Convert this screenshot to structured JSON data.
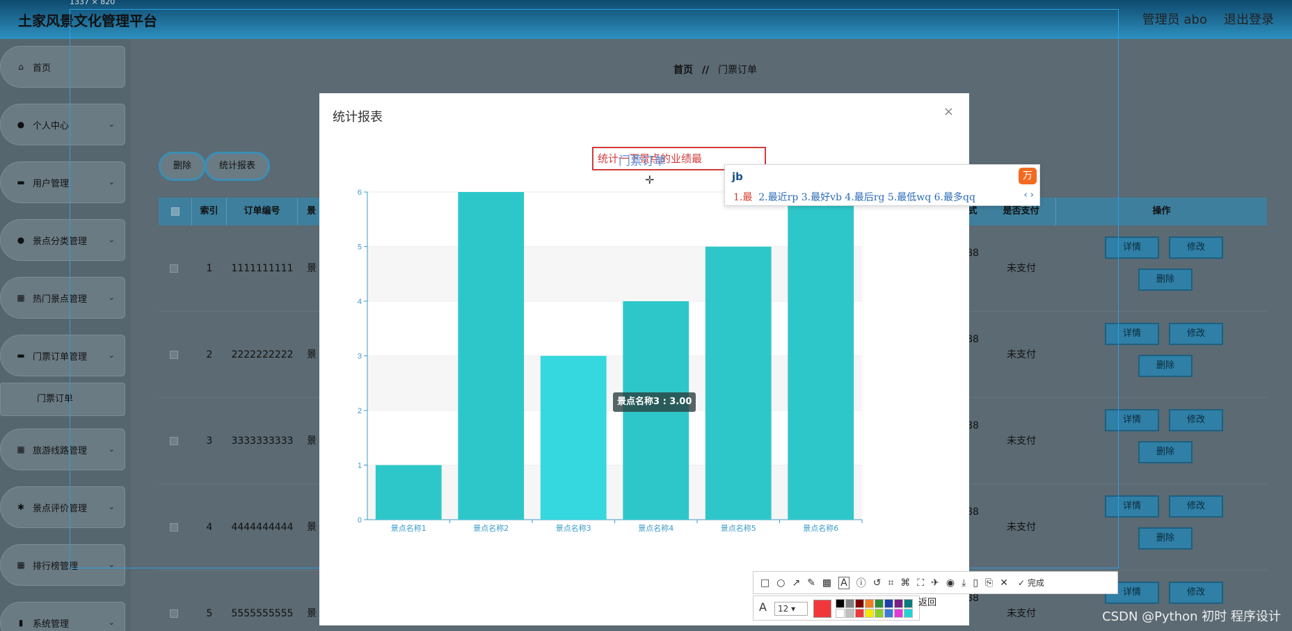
{
  "app_title": "土家风景文化管理平台",
  "header": {
    "user": "管理员 abo",
    "logout": "退出登录"
  },
  "screenshot_size_label": "1337 × 820",
  "sidebar": {
    "items": [
      {
        "label": "首页",
        "icon": "home-icon"
      },
      {
        "label": "个人中心",
        "icon": "user-icon"
      },
      {
        "label": "用户管理",
        "icon": "chat-icon"
      },
      {
        "label": "景点分类管理",
        "icon": "user-icon"
      },
      {
        "label": "热门景点管理",
        "icon": "grid-icon"
      },
      {
        "label": "门票订单管理",
        "icon": "ticket-icon"
      },
      {
        "label": "旅游线路管理",
        "icon": "grid-icon"
      },
      {
        "label": "景点评价管理",
        "icon": "star-icon"
      },
      {
        "label": "排行榜管理",
        "icon": "grid-icon"
      },
      {
        "label": "系统管理",
        "icon": "chart-icon"
      }
    ],
    "sub_item": "门票订单"
  },
  "breadcrumb": {
    "home": "首页",
    "sep": "//",
    "current": "门票订单"
  },
  "toolbar": {
    "delete": "删除",
    "report": "统计报表"
  },
  "table": {
    "headers": [
      "索引",
      "订单编号",
      "景",
      "式",
      "是否支付",
      "操作"
    ],
    "rows": [
      {
        "index": "1",
        "order_no": "1111111111",
        "col3": "景",
        "price": "88",
        "paid": "未支付"
      },
      {
        "index": "2",
        "order_no": "2222222222",
        "col3": "景",
        "price": "88",
        "paid": "未支付"
      },
      {
        "index": "3",
        "order_no": "3333333333",
        "col3": "景",
        "price": "88",
        "paid": "未支付"
      },
      {
        "index": "4",
        "order_no": "4444444444",
        "col3": "景",
        "price": "88",
        "paid": "未支付"
      },
      {
        "index": "5",
        "order_no": "5555555555",
        "col3": "景",
        "price": "88",
        "paid": "未支付"
      }
    ],
    "actions": {
      "detail": "详情",
      "edit": "修改",
      "delete": "删除"
    }
  },
  "modal": {
    "title": "统计报表",
    "close": "×",
    "title_input_text": "统计一下景点的业绩最",
    "title_overlay_text": "门票订单"
  },
  "chart_data": {
    "type": "bar",
    "categories": [
      "景点名称1",
      "景点名称2",
      "景点名称3",
      "景点名称4",
      "景点名称5",
      "景点名称6"
    ],
    "values": [
      1,
      6,
      3,
      4,
      5,
      6
    ],
    "ylim": [
      0,
      6
    ],
    "yticks": [
      0,
      1,
      2,
      3,
      4,
      5,
      6
    ],
    "tooltip": "景点名称3 : 3.00",
    "highlight_index": 2,
    "bar_color": "#2ec7c9",
    "highlight_color": "#35d8de",
    "grid": true
  },
  "ime": {
    "input": "jb",
    "first": "1.最",
    "candidates": "2.最近rp  3.最好vb  4.最后rg  5.最低wq  6.最多qq",
    "nav": "‹ ›",
    "logo": "万"
  },
  "snap_toolbar": {
    "done": "完成",
    "font_size": "12",
    "return": "返回"
  },
  "watermark": "CSDN @Python 初时 程序设计"
}
